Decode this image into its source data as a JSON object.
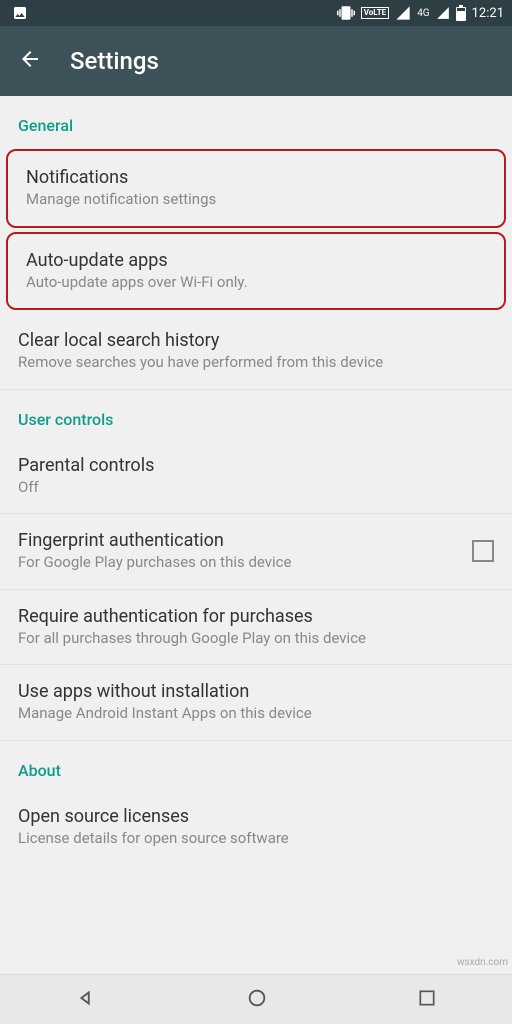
{
  "statusbar": {
    "volte": "VoLTE",
    "network_label": "4G",
    "time": "12:21"
  },
  "appbar": {
    "title": "Settings"
  },
  "sections": {
    "general": {
      "header": "General",
      "notifications": {
        "title": "Notifications",
        "subtitle": "Manage notification settings"
      },
      "auto_update": {
        "title": "Auto-update apps",
        "subtitle": "Auto-update apps over Wi-Fi only."
      },
      "clear_history": {
        "title": "Clear local search history",
        "subtitle": "Remove searches you have performed from this device"
      }
    },
    "user_controls": {
      "header": "User controls",
      "parental": {
        "title": "Parental controls",
        "subtitle": "Off"
      },
      "fingerprint": {
        "title": "Fingerprint authentication",
        "subtitle": "For Google Play purchases on this device",
        "checked": false
      },
      "require_auth": {
        "title": "Require authentication for purchases",
        "subtitle": "For all purchases through Google Play on this device"
      },
      "instant_apps": {
        "title": "Use apps without installation",
        "subtitle": "Manage Android Instant Apps on this device"
      }
    },
    "about": {
      "header": "About",
      "licenses": {
        "title": "Open source licenses",
        "subtitle": "License details for open source software"
      }
    }
  },
  "watermark": "wsxdn.com"
}
